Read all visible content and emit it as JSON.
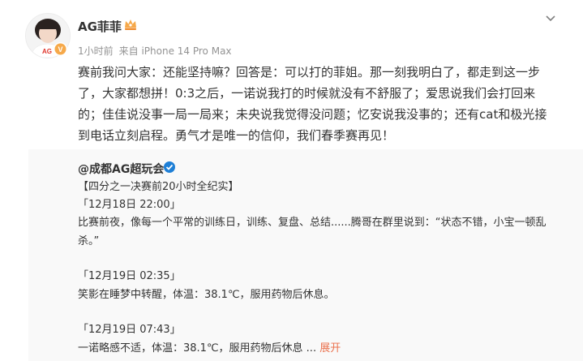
{
  "post": {
    "author": {
      "name": "AG菲菲"
    },
    "meta": {
      "time": "1小时前",
      "source": "来自 iPhone 14 Pro Max"
    },
    "text_lines": [
      "赛前我问大家：还能坚持嘛？回答是：可以打的菲姐。那一刻我明白了，都走到这一步",
      "了，大家都想拼！0:3之后，一诺说我打的时候就没有不舒服了；爱思说我们会打回来",
      "的；佳佳说没事一局一局来；未央说我觉得没问题；忆安说我没事的；还有cat和极光接",
      "到电话立刻启程。勇气才是唯一的信仰，我们春季赛再见！"
    ]
  },
  "repost": {
    "author": "@成都AG超玩会",
    "headline": "【四分之一决赛前20小时全纪实】",
    "entries": [
      {
        "time": "「12月18日 22:00」",
        "lines": [
          "比赛前夜，像每一个平常的训练日，训练、复盘、总结......腾哥在群里说到：“状态不错，小宝一顿乱",
          "杀。”"
        ]
      },
      {
        "time": "「12月19日 02:35」",
        "lines": [
          "笑影在睡梦中转醒，体温：38.1℃，服用药物后休息。"
        ]
      },
      {
        "time": "「12月19日 07:43」",
        "lines": [
          "一诺略感不适，体温：38.1℃，服用药物后休息"
        ]
      }
    ],
    "ellipsis": " ... ",
    "expand_label": "展开"
  },
  "icons": {
    "more": "chevron-down-icon",
    "vip": "vip-crown-icon",
    "verified": "verified-badge-icon",
    "blue_v": "blue-verified-icon"
  },
  "colors": {
    "link_orange": "#eb7350",
    "verified_blue": "#1e7fd6",
    "vip_gold": "#f6a94a",
    "meta_gray": "#939393"
  }
}
